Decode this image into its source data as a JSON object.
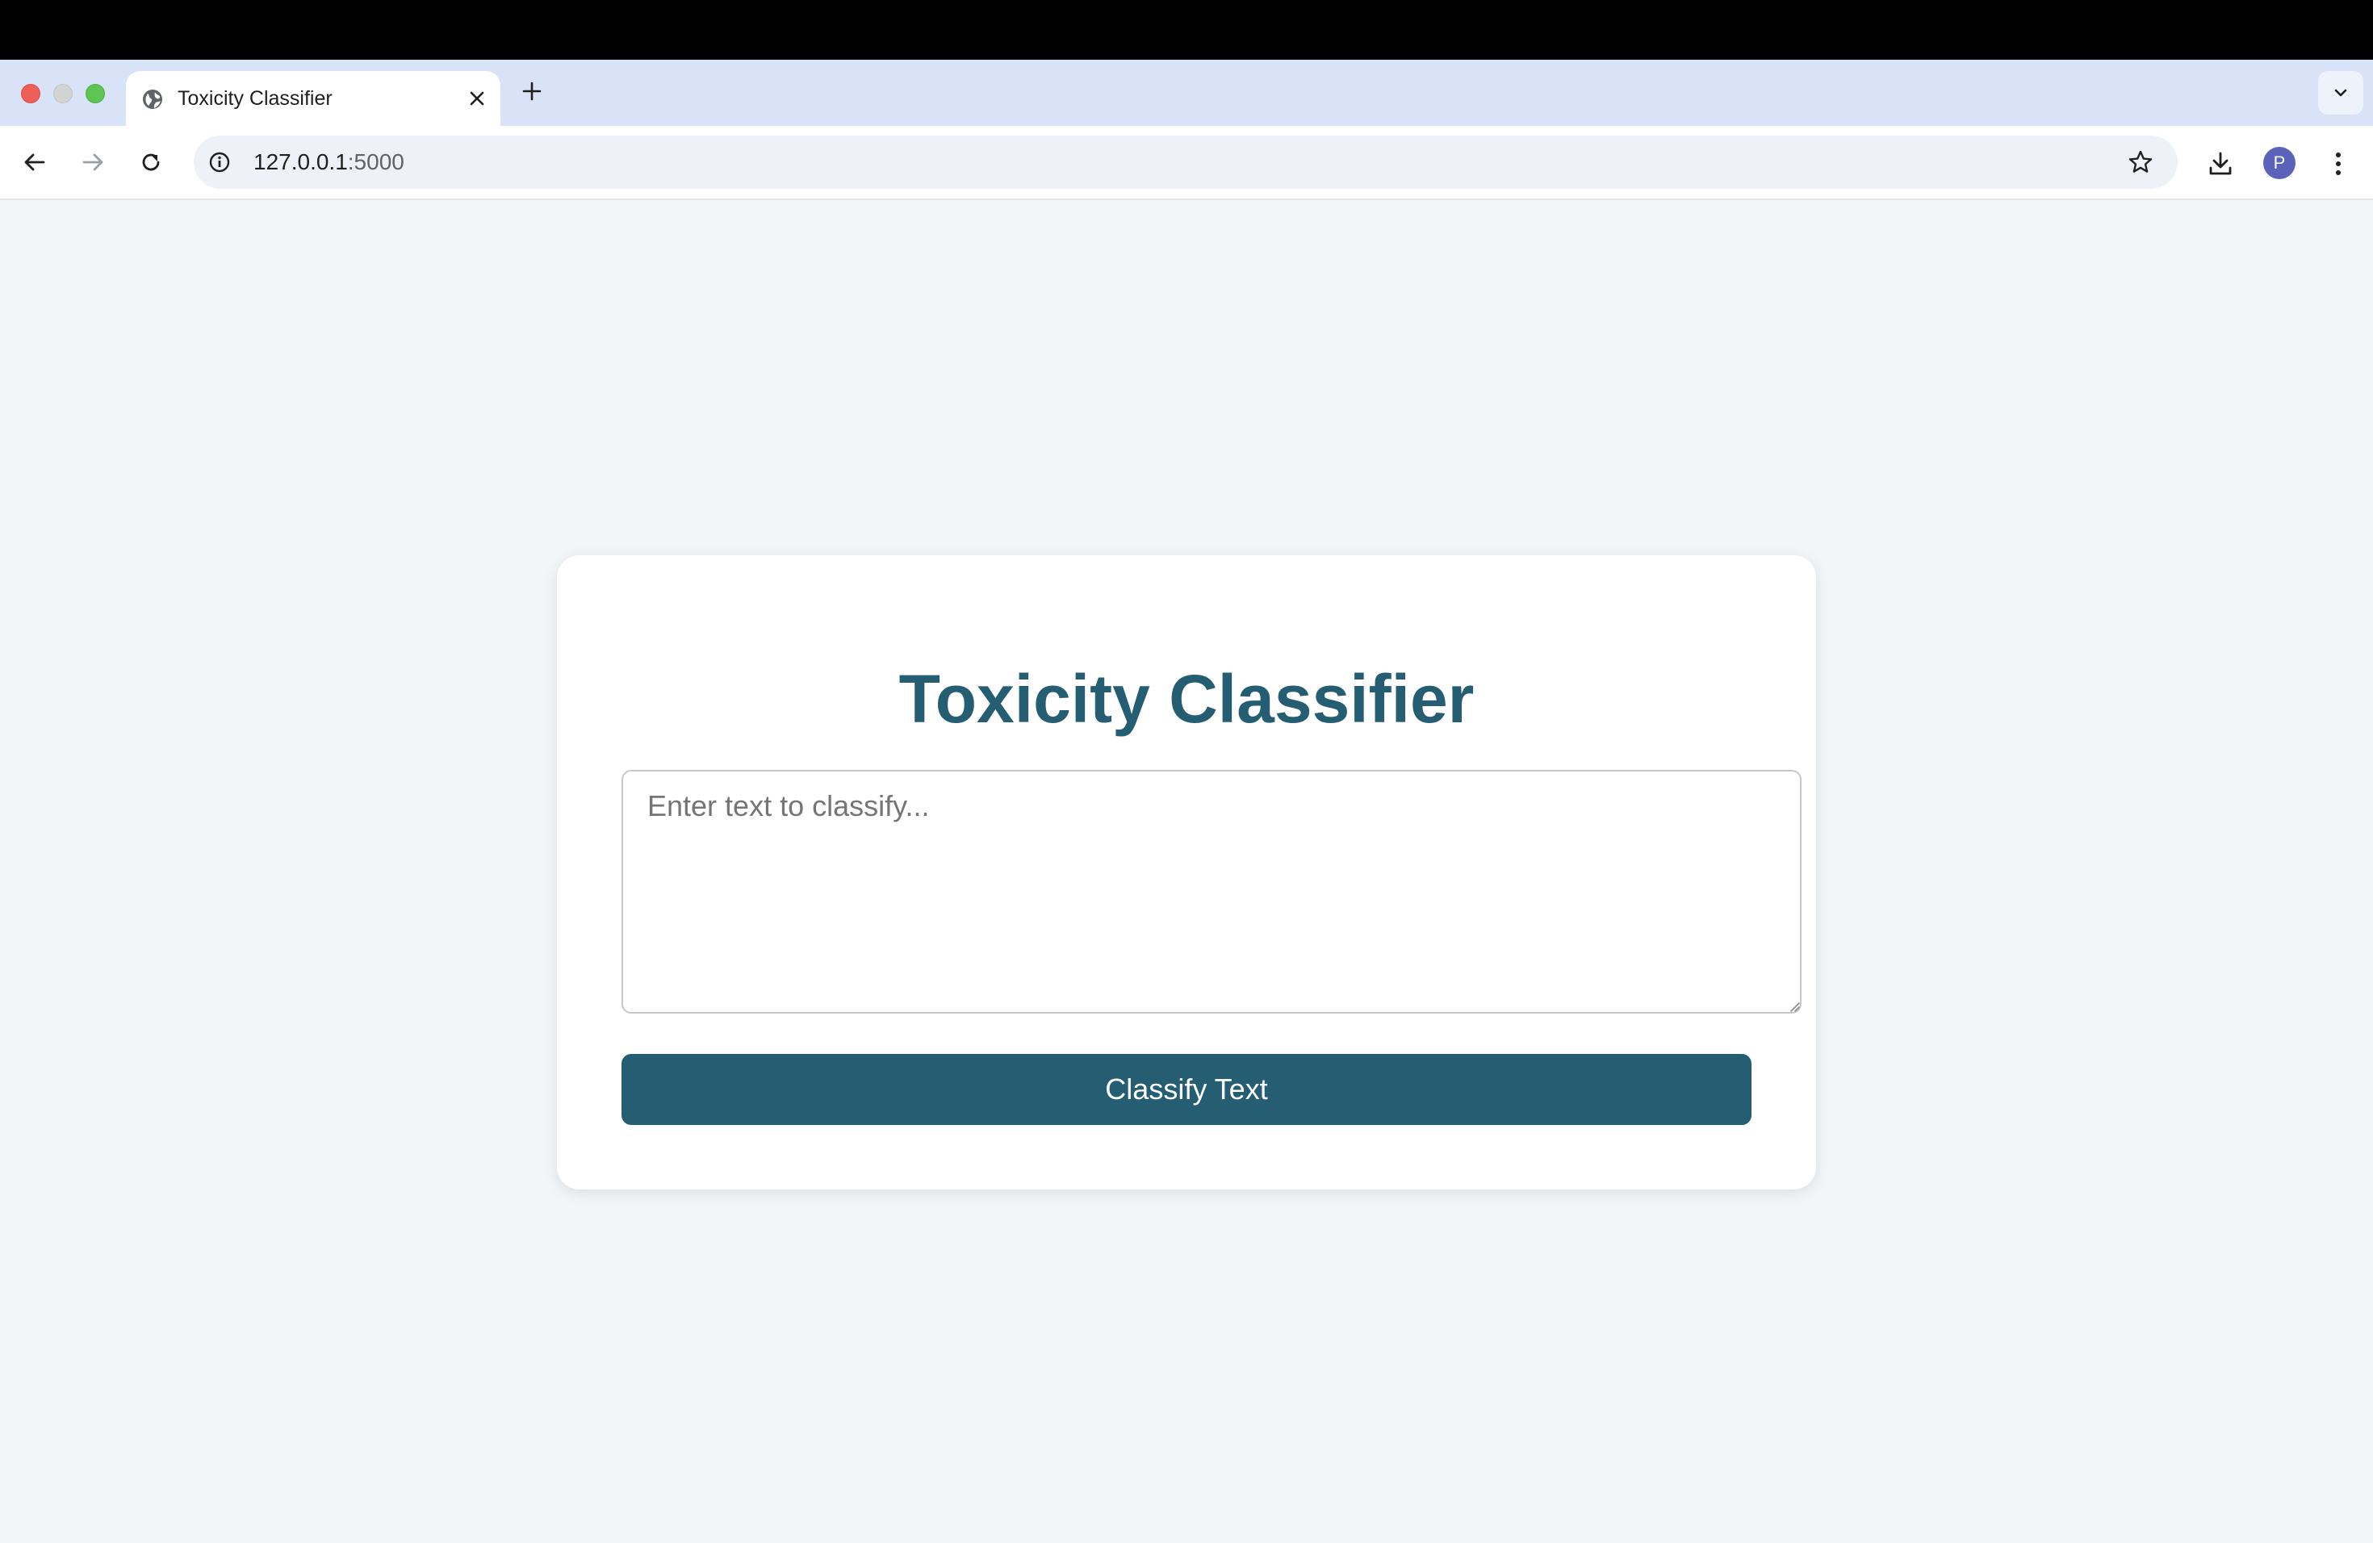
{
  "browser": {
    "tab": {
      "title": "Toxicity Classifier",
      "favicon": "globe-icon"
    },
    "url": {
      "host": "127.0.0.1",
      "port": ":5000"
    },
    "profile_initial": "P"
  },
  "page": {
    "title": "Toxicity Classifier",
    "input_placeholder": "Enter text to classify...",
    "input_value": "",
    "button_label": "Classify Text"
  },
  "colors": {
    "accent": "#255d72",
    "page_background": "#f3f6f9",
    "tab_strip": "#d9e3f8",
    "avatar": "#5a63b9"
  }
}
